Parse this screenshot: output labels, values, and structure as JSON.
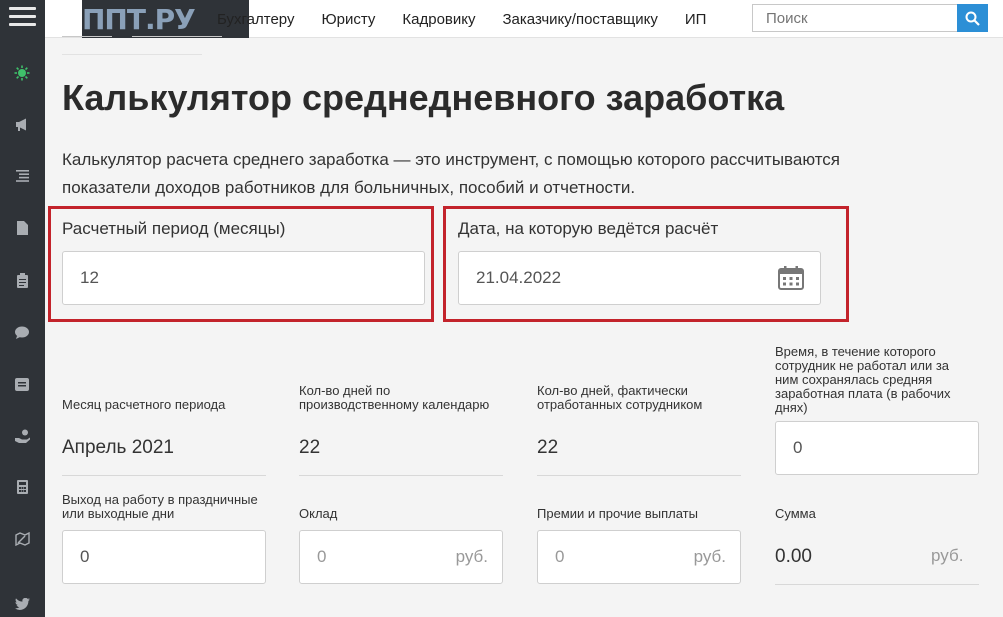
{
  "nav": {
    "logo": "ППТ.РУ",
    "links": [
      "Бухгалтеру",
      "Юристу",
      "Кадровику",
      "Заказчику/поставщику",
      "ИП"
    ],
    "search_placeholder": "Поиск"
  },
  "page": {
    "title": "Калькулятор среднедневного заработка",
    "description": "Калькулятор расчета среднего заработка — это инструмент, с помощью которого рассчитываются показатели доходов работников для больничных, пособий и отчетности."
  },
  "period": {
    "label": "Расчетный период (месяцы)",
    "value": "12"
  },
  "date": {
    "label": "Дата, на которую ведётся расчёт",
    "value": "21.04.2022"
  },
  "table": {
    "col_month": "Месяц расчетного периода",
    "col_calendar_days": "Кол-во дней по производственному календарю",
    "col_worked_days": "Кол-во дней, фактически отработанных сотрудником",
    "col_absent": "Время, в течение которого сотрудник не работал или за ним сохранялась средняя заработная плата (в рабочих днях)",
    "month_value": "Апрель 2021",
    "calendar_days_value": "22",
    "worked_days_value": "22",
    "absent_value": "0",
    "col_holiday": "Выход на работу в праздничные или выходные дни",
    "col_salary": "Оклад",
    "col_bonus": "Премии и прочие выплаты",
    "col_sum": "Сумма",
    "holiday_value": "0",
    "salary_value": "0",
    "bonus_value": "0",
    "sum_value": "0.00",
    "currency": "руб."
  }
}
